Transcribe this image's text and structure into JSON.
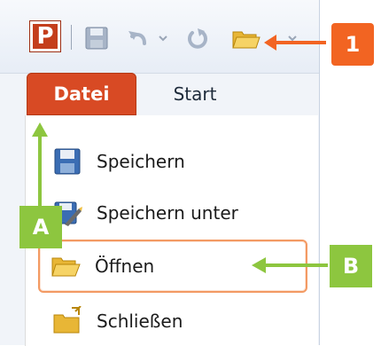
{
  "app": {
    "logo_letter": "P"
  },
  "ribbon": {
    "tabs": [
      {
        "label": "Datei",
        "active": true
      },
      {
        "label": "Start",
        "active": false
      }
    ]
  },
  "menu": {
    "items": [
      {
        "label": "Speichern",
        "icon": "save-icon"
      },
      {
        "label": "Speichern unter",
        "icon": "save-as-icon"
      },
      {
        "label": "Öffnen",
        "icon": "open-folder-icon",
        "selected": true
      },
      {
        "label": "Schließen",
        "icon": "close-folder-icon"
      }
    ]
  },
  "callouts": {
    "one": "1",
    "a": "A",
    "b": "B"
  },
  "colors": {
    "file_tab": "#d84a24",
    "callout_orange": "#f26422",
    "callout_green": "#8dc63f",
    "selected_border": "#f39a63"
  }
}
